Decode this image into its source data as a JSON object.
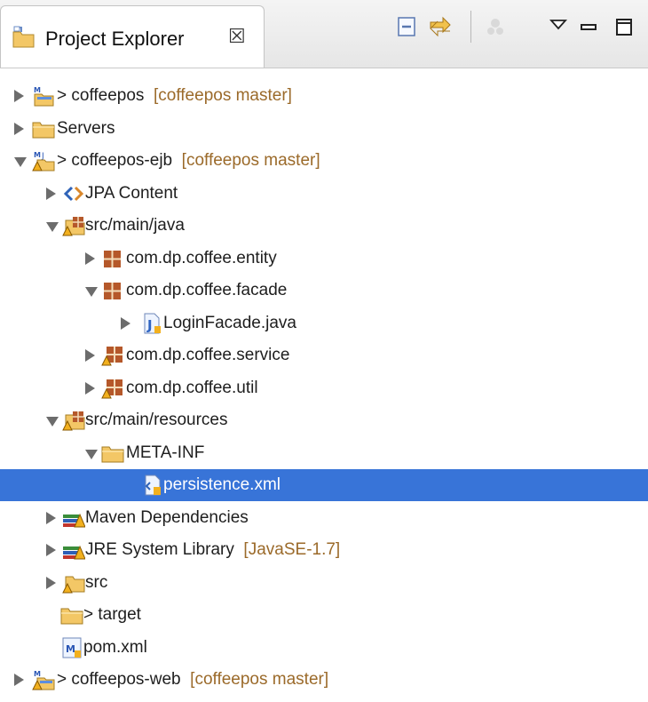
{
  "view": {
    "title": "Project Explorer",
    "close_glyph": "☒"
  },
  "toolbar": {
    "buttons": [
      {
        "name": "collapse-all-button",
        "icon": "collapse-all-icon"
      },
      {
        "name": "link-with-editor-button",
        "icon": "link-with-editor-icon"
      },
      {
        "name": "focus-button",
        "icon": "focus-icon"
      },
      {
        "name": "view-menu-button",
        "icon": "view-menu-icon"
      },
      {
        "name": "minimize-button",
        "icon": "minimize-icon"
      },
      {
        "name": "maximize-button",
        "icon": "maximize-icon"
      }
    ]
  },
  "tree": {
    "items": [
      {
        "label": "> coffeepos",
        "decoration": "[coffeepos master]",
        "icon": "maven-project-icon",
        "expand": "closed",
        "depth": 0
      },
      {
        "label": "Servers",
        "decoration": "",
        "icon": "folder-icon",
        "expand": "closed",
        "depth": 0
      },
      {
        "label": "> coffeepos-ejb",
        "decoration": "[coffeepos master]",
        "icon": "maven-ejb-project-icon",
        "expand": "open",
        "depth": 0
      },
      {
        "label": "JPA Content",
        "decoration": "",
        "icon": "jpa-content-icon",
        "expand": "closed",
        "depth": 1
      },
      {
        "label": "src/main/java",
        "decoration": "",
        "icon": "source-folder-icon",
        "expand": "open",
        "depth": 1
      },
      {
        "label": "com.dp.coffee.entity",
        "decoration": "",
        "icon": "package-icon",
        "expand": "closed",
        "depth": 2
      },
      {
        "label": "com.dp.coffee.facade",
        "decoration": "",
        "icon": "package-icon",
        "expand": "open",
        "depth": 2
      },
      {
        "label": "LoginFacade.java",
        "decoration": "",
        "icon": "java-file-icon",
        "expand": "closed",
        "depth": 3
      },
      {
        "label": "com.dp.coffee.service",
        "decoration": "",
        "icon": "package-warning-icon",
        "expand": "closed",
        "depth": 2
      },
      {
        "label": "com.dp.coffee.util",
        "decoration": "",
        "icon": "package-warning-icon",
        "expand": "closed",
        "depth": 2
      },
      {
        "label": "src/main/resources",
        "decoration": "",
        "icon": "source-folder-icon",
        "expand": "open",
        "depth": 1
      },
      {
        "label": "META-INF",
        "decoration": "",
        "icon": "folder-icon",
        "expand": "open",
        "depth": 2
      },
      {
        "label": "persistence.xml",
        "decoration": "",
        "icon": "xml-file-icon",
        "expand": "none",
        "depth": 3,
        "selected": true
      },
      {
        "label": "Maven Dependencies",
        "decoration": "",
        "icon": "library-icon",
        "expand": "closed",
        "depth": 1
      },
      {
        "label": "JRE System Library",
        "decoration": "[JavaSE-1.7]",
        "icon": "library-icon",
        "expand": "closed",
        "depth": 1
      },
      {
        "label": "src",
        "decoration": "",
        "icon": "folder-warning-icon",
        "expand": "closed",
        "depth": 1
      },
      {
        "label": "> target",
        "decoration": "",
        "icon": "folder-icon",
        "expand": "none",
        "depth": 1
      },
      {
        "label": "pom.xml",
        "decoration": "",
        "icon": "pom-file-icon",
        "expand": "none",
        "depth": 1
      },
      {
        "label": "> coffeepos-web",
        "decoration": "[coffeepos master]",
        "icon": "maven-web-project-icon",
        "expand": "closed",
        "depth": 0
      }
    ]
  },
  "colors": {
    "selection": "#3874d8",
    "decoration": "#9b6a2a",
    "folder": "#f3c766",
    "package": "#b5582a"
  }
}
